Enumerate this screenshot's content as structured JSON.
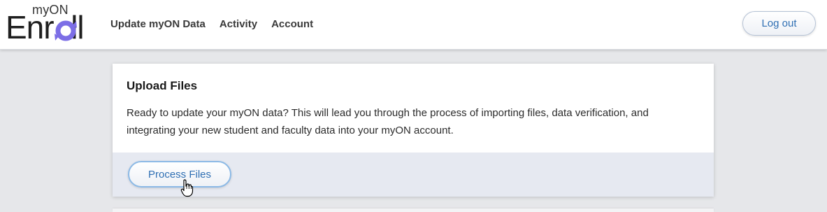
{
  "header": {
    "logo_top": "myON",
    "logo_main_prefix": "Enr",
    "logo_main_suffix": "ll",
    "nav": [
      {
        "label": "Update myON Data"
      },
      {
        "label": "Activity"
      },
      {
        "label": "Account"
      }
    ],
    "logout_label": "Log out"
  },
  "card": {
    "title": "Upload Files",
    "body": "Ready to update your myON data? This will lead you through the process of importing files, data verification, and integrating your new student and faculty data into your myON account.",
    "button_label": "Process Files"
  },
  "colors": {
    "accent": "#2f6fb3",
    "logo_ring": "#7c6ee6",
    "background": "#e6e7ea",
    "footer": "#e6e9f1"
  },
  "icons": {
    "cursor": "hand-pointer-icon"
  }
}
